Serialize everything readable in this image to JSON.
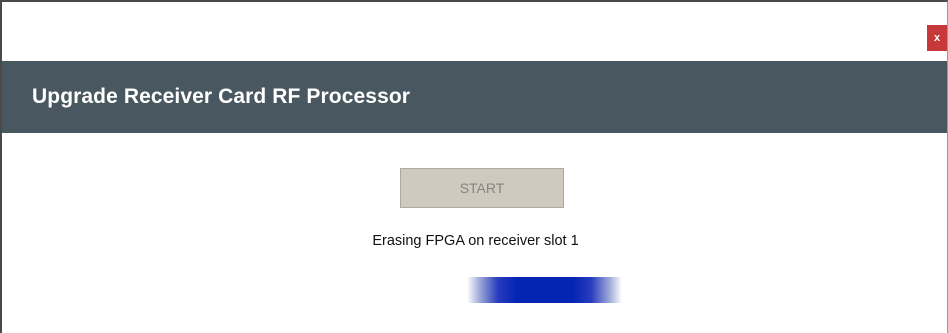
{
  "window": {
    "close_label": "x"
  },
  "header": {
    "title": "Upgrade Receiver Card RF Processor"
  },
  "actions": {
    "start_label": "START"
  },
  "status": {
    "message": "Erasing FPGA on receiver slot 1"
  },
  "progress": {
    "state": "indeterminate",
    "color": "#0424b4"
  },
  "colors": {
    "header_bg": "#495860",
    "close_bg": "#c7383a",
    "button_disabled_bg": "#d0c9c0"
  }
}
